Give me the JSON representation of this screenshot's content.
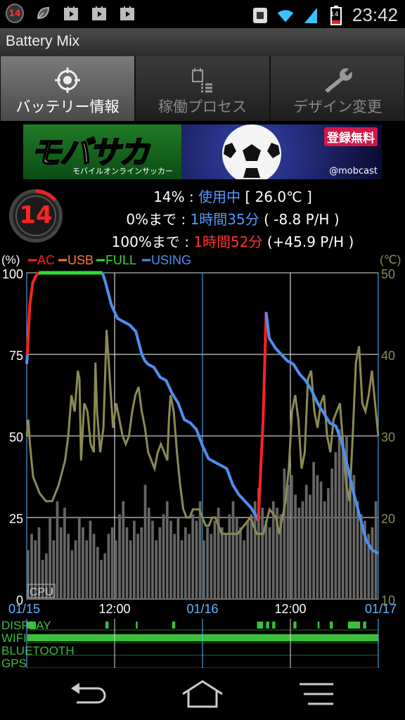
{
  "status_bar": {
    "time": "23:42",
    "notification_badge": "14",
    "battery_badge": "14",
    "left_icons": [
      "battery-mix-badge-icon",
      "leaf-icon",
      "play-store-icon",
      "play-store-icon",
      "play-store-icon"
    ],
    "right_icons": [
      "sim-icon",
      "wifi-icon",
      "signal-icon",
      "battery-icon"
    ]
  },
  "app": {
    "title": "Battery Mix"
  },
  "tabs": [
    {
      "label": "バッテリー情報",
      "icon": "target-icon",
      "active": true
    },
    {
      "label": "稼働プロセス",
      "icon": "process-list-icon",
      "active": false
    },
    {
      "label": "デザイン変更",
      "icon": "wrench-icon",
      "active": false
    }
  ],
  "banner": {
    "logo": "モバサカ",
    "subtitle": "モバイルオンラインサッカー",
    "badge": "登録無料",
    "handle": "@mobcast"
  },
  "battery": {
    "level": "14",
    "level_fraction": 0.14,
    "line1": {
      "percent": "14%",
      "sep": " : ",
      "state": "使用中",
      "temp": " [ 26.0℃ ]"
    },
    "line2": {
      "label": "0%まで",
      "sep": " : ",
      "time": "1時間35分",
      "rate": " ( -8.8 P/H )"
    },
    "line3": {
      "label": "100%まで",
      "sep": " : ",
      "time": "1時間52分",
      "rate": " (+45.9 P/H )"
    }
  },
  "colors": {
    "ac": "#ff2222",
    "usb": "#ff7733",
    "full": "#33dd33",
    "using": "#4f8ef0",
    "temp": "#8b8a55",
    "cpu": "#666666",
    "grid": "#ffffff",
    "day_line": "#5bb8ff"
  },
  "chart_data": {
    "type": "line",
    "y_left_unit": "(%)",
    "y_right_unit": "(℃)",
    "y_left_ticks": [
      "100",
      "75",
      "50",
      "25",
      "0"
    ],
    "y_right_ticks": [
      "50",
      "40",
      "30",
      "20",
      "10"
    ],
    "ylim": [
      0,
      100
    ],
    "ylim_right": [
      10,
      50
    ],
    "x_ticks": [
      "01/15",
      "12:00",
      "01/16",
      "12:00",
      "01/17"
    ],
    "x_range_hours": [
      0,
      48
    ],
    "legend": [
      {
        "name": "AC",
        "color_key": "ac"
      },
      {
        "name": "USB",
        "color_key": "usb"
      },
      {
        "name": "FULL",
        "color_key": "full"
      },
      {
        "name": "USING",
        "color_key": "using"
      }
    ],
    "cpu_label": "CPU",
    "series": [
      {
        "name": "USING",
        "segment": "a",
        "points": [
          [
            0,
            72
          ],
          [
            0.1,
            75
          ]
        ]
      },
      {
        "name": "AC",
        "segment": "a",
        "points": [
          [
            0.1,
            75
          ],
          [
            0.5,
            90
          ],
          [
            1.0,
            97
          ],
          [
            1.5,
            99
          ],
          [
            2.0,
            100
          ]
        ]
      },
      {
        "name": "FULL",
        "points": [
          [
            2.0,
            100
          ],
          [
            12.5,
            100
          ]
        ]
      },
      {
        "name": "USING",
        "segment": "b",
        "points": [
          [
            12.5,
            100
          ],
          [
            13,
            97
          ],
          [
            14,
            90
          ],
          [
            15,
            86
          ],
          [
            16,
            85
          ],
          [
            17,
            84
          ],
          [
            18,
            82
          ],
          [
            19,
            75
          ],
          [
            19.5,
            73
          ],
          [
            20,
            72
          ],
          [
            21,
            71
          ],
          [
            22,
            68
          ],
          [
            23,
            67
          ],
          [
            24,
            63
          ],
          [
            25,
            60
          ],
          [
            26,
            55
          ],
          [
            27,
            54
          ],
          [
            28,
            52
          ],
          [
            29,
            47
          ],
          [
            30,
            43
          ],
          [
            31,
            42
          ],
          [
            32,
            41
          ],
          [
            33,
            40
          ],
          [
            34,
            35
          ],
          [
            35,
            32
          ],
          [
            36,
            30
          ],
          [
            37,
            28
          ],
          [
            38,
            25
          ],
          [
            38.2,
            24
          ]
        ]
      },
      {
        "name": "AC",
        "segment": "b",
        "points": [
          [
            38.2,
            24
          ],
          [
            39,
            55
          ],
          [
            39.5,
            88
          ]
        ]
      },
      {
        "name": "USING",
        "segment": "c",
        "points": [
          [
            39.5,
            88
          ],
          [
            40,
            80
          ],
          [
            41,
            77
          ],
          [
            42,
            75
          ],
          [
            43,
            73
          ],
          [
            44,
            72
          ],
          [
            45,
            69
          ],
          [
            46,
            67
          ],
          [
            47,
            64
          ],
          [
            48,
            60
          ],
          [
            50,
            54
          ],
          [
            51,
            53
          ],
          [
            52,
            48
          ],
          [
            53,
            40
          ],
          [
            54,
            32
          ],
          [
            55,
            25
          ],
          [
            56,
            18
          ],
          [
            57,
            15
          ],
          [
            58,
            14
          ]
        ]
      },
      {
        "name": "TEMP",
        "points": [
          [
            0,
            30
          ],
          [
            0.5,
            32
          ],
          [
            1,
            29
          ],
          [
            2,
            25
          ],
          [
            4,
            23
          ],
          [
            6,
            22
          ],
          [
            8,
            22
          ],
          [
            10,
            24
          ],
          [
            12,
            27
          ],
          [
            13,
            30
          ],
          [
            14,
            35
          ],
          [
            15,
            33
          ],
          [
            16,
            38
          ],
          [
            16.5,
            37
          ],
          [
            17,
            27
          ],
          [
            18,
            34
          ],
          [
            19,
            33
          ],
          [
            20,
            29
          ],
          [
            21,
            28
          ],
          [
            21.5,
            39
          ],
          [
            22,
            33
          ],
          [
            23,
            28
          ],
          [
            24,
            31
          ],
          [
            25,
            43
          ],
          [
            26,
            37
          ],
          [
            27,
            31
          ],
          [
            28,
            34
          ],
          [
            29,
            32
          ],
          [
            30,
            30
          ],
          [
            31,
            29
          ],
          [
            32,
            30
          ],
          [
            33,
            33
          ],
          [
            34,
            35
          ],
          [
            35,
            36
          ],
          [
            36,
            33
          ],
          [
            37,
            31
          ],
          [
            38,
            28
          ],
          [
            39,
            27
          ],
          [
            40,
            26
          ],
          [
            41,
            28
          ],
          [
            42,
            29
          ],
          [
            43,
            28
          ],
          [
            44,
            27
          ],
          [
            44.5,
            32
          ],
          [
            45,
            35
          ],
          [
            46,
            33
          ],
          [
            47,
            28
          ],
          [
            48,
            24
          ],
          [
            49,
            21
          ],
          [
            50,
            20
          ],
          [
            51,
            20
          ],
          [
            52,
            21
          ],
          [
            54,
            21
          ],
          [
            55,
            20
          ],
          [
            56,
            19
          ],
          [
            57,
            19
          ],
          [
            58,
            20
          ],
          [
            59,
            20
          ],
          [
            60,
            19
          ],
          [
            61,
            18
          ],
          [
            62,
            18
          ],
          [
            63,
            18
          ],
          [
            64,
            18
          ],
          [
            66,
            18
          ],
          [
            68,
            19
          ],
          [
            70,
            20
          ],
          [
            72,
            18
          ],
          [
            74,
            18
          ],
          [
            76,
            21
          ],
          [
            78,
            20
          ],
          [
            79,
            18
          ],
          [
            80,
            20
          ],
          [
            81,
            22
          ],
          [
            82,
            26
          ],
          [
            83,
            33
          ],
          [
            84,
            35
          ],
          [
            85,
            32
          ],
          [
            86,
            26
          ],
          [
            87,
            28
          ],
          [
            88,
            37
          ],
          [
            89,
            38
          ],
          [
            90,
            33
          ],
          [
            91,
            31
          ],
          [
            92,
            34
          ],
          [
            93,
            35
          ],
          [
            94,
            30
          ],
          [
            95,
            28
          ],
          [
            96,
            32
          ],
          [
            97,
            33
          ],
          [
            98,
            34
          ],
          [
            99,
            29
          ],
          [
            100,
            24
          ],
          [
            101,
            22
          ],
          [
            102,
            30
          ],
          [
            103,
            39
          ],
          [
            104,
            41
          ],
          [
            105,
            34
          ],
          [
            106,
            33
          ],
          [
            107,
            35
          ],
          [
            108,
            38
          ],
          [
            109,
            34
          ],
          [
            110,
            30
          ]
        ]
      },
      {
        "name": "CPU",
        "values": [
          15,
          20,
          18,
          22,
          12,
          14,
          25,
          18,
          30,
          22,
          28,
          20,
          15,
          18,
          25,
          22,
          18,
          24,
          20,
          16,
          12,
          14,
          20,
          22,
          18,
          26,
          30,
          22,
          18,
          24,
          20,
          22,
          35,
          28,
          24,
          18,
          22,
          26,
          30,
          24,
          20,
          25,
          18,
          22,
          20,
          26,
          24,
          30,
          18,
          22,
          20,
          24,
          28,
          22,
          20,
          26,
          30,
          25,
          22,
          18,
          24,
          26,
          30,
          34,
          28,
          24,
          22,
          30,
          28,
          26,
          40,
          35,
          38,
          32,
          28,
          30,
          35,
          32,
          42,
          38,
          36,
          30,
          34,
          40,
          45,
          52,
          48,
          50,
          40,
          38,
          30,
          26,
          24,
          20,
          22,
          30
        ]
      }
    ]
  },
  "state_rows": [
    {
      "label": "DISPLAY",
      "bars": [
        [
          0,
          1.5
        ],
        [
          13,
          13.5
        ],
        [
          18,
          18.3
        ],
        [
          24,
          24.5
        ],
        [
          38,
          39
        ],
        [
          39.5,
          40
        ],
        [
          40.5,
          41
        ],
        [
          44,
          44.5
        ],
        [
          48,
          48.3
        ],
        [
          50,
          50.5
        ],
        [
          53,
          55
        ],
        [
          55.5,
          56
        ]
      ]
    },
    {
      "label": "WIFI",
      "bars": [
        [
          0.1,
          58
        ]
      ]
    },
    {
      "label": "BLUETOOTH",
      "bars": []
    },
    {
      "label": "GPS",
      "bars": []
    }
  ],
  "nav": {
    "buttons": [
      "back-icon",
      "home-icon",
      "menu-icon"
    ]
  }
}
